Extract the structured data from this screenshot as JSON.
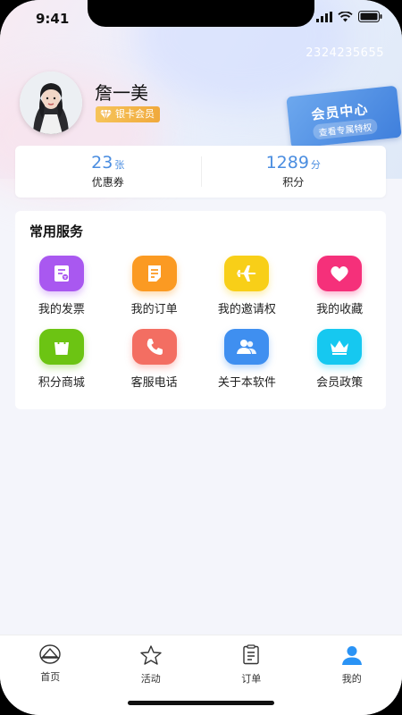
{
  "status": {
    "time": "9:41"
  },
  "profile": {
    "phone": "2324235655",
    "name": "詹一美",
    "badge": "银卡会员"
  },
  "member_center": {
    "title": "会员中心",
    "subtitle": "查看专属特权"
  },
  "stats": [
    {
      "value": "23",
      "unit": "张",
      "label": "优惠券"
    },
    {
      "value": "1289",
      "unit": "分",
      "label": "积分"
    }
  ],
  "services": {
    "title": "常用服务",
    "items": [
      {
        "label": "我的发票",
        "icon": "invoice-icon",
        "color": "#a958f0"
      },
      {
        "label": "我的订单",
        "icon": "order-icon",
        "color": "#fb9a22"
      },
      {
        "label": "我的邀请权",
        "icon": "airplane-icon",
        "color": "#f8cf18"
      },
      {
        "label": "我的收藏",
        "icon": "heart-icon",
        "color": "#f5307a"
      },
      {
        "label": "积分商城",
        "icon": "shopping-bag-icon",
        "color": "#6cc413"
      },
      {
        "label": "客服电话",
        "icon": "phone-icon",
        "color": "#f36e62"
      },
      {
        "label": "关于本软件",
        "icon": "users-icon",
        "color": "#3f8ff0"
      },
      {
        "label": "会员政策",
        "icon": "crown-icon",
        "color": "#16c8f0"
      }
    ]
  },
  "tabbar": [
    {
      "label": "首页",
      "icon": "home-icon"
    },
    {
      "label": "活动",
      "icon": "star-icon"
    },
    {
      "label": "订单",
      "icon": "orders-icon"
    },
    {
      "label": "我的",
      "icon": "user-icon",
      "active_color": "#2a93f5"
    }
  ]
}
